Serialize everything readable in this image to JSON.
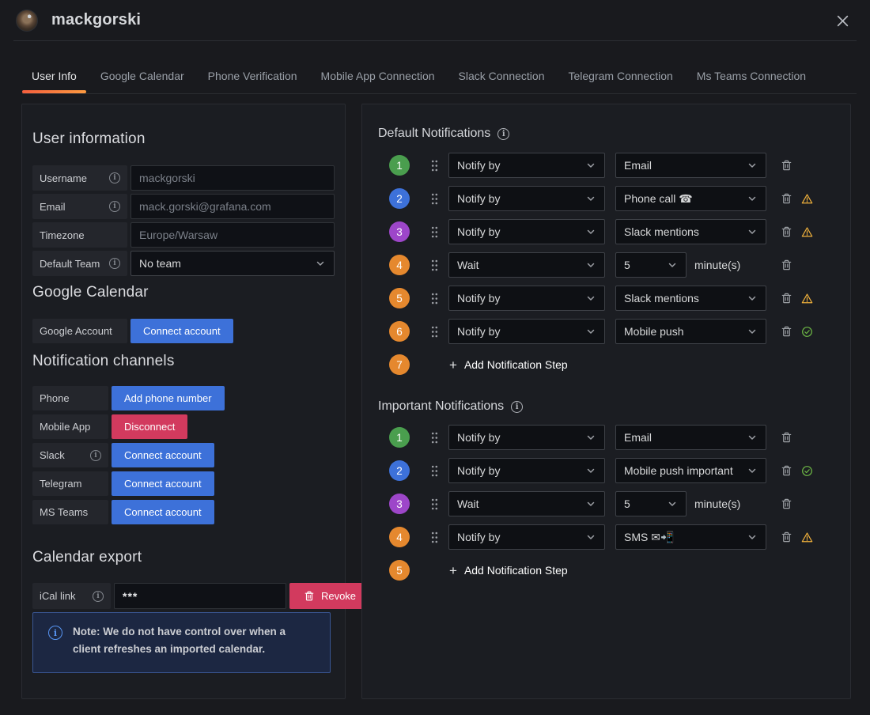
{
  "window": {
    "title": "mackgorski"
  },
  "tabs": [
    {
      "label": "User Info",
      "active": true
    },
    {
      "label": "Google Calendar",
      "active": false
    },
    {
      "label": "Phone Verification",
      "active": false
    },
    {
      "label": "Mobile App Connection",
      "active": false
    },
    {
      "label": "Slack Connection",
      "active": false
    },
    {
      "label": "Telegram Connection",
      "active": false
    },
    {
      "label": "Ms Teams Connection",
      "active": false
    }
  ],
  "user_info": {
    "heading": "User information",
    "fields": [
      {
        "label": "Username",
        "info": true,
        "value": "mackgorski",
        "type": "text"
      },
      {
        "label": "Email",
        "info": true,
        "value": "mack.gorski@grafana.com",
        "type": "text"
      },
      {
        "label": "Timezone",
        "info": false,
        "value": "Europe/Warsaw",
        "type": "text"
      },
      {
        "label": "Default Team",
        "info": true,
        "value": "No team",
        "type": "select"
      }
    ]
  },
  "google_calendar": {
    "heading": "Google Calendar",
    "row": {
      "label": "Google Account",
      "button": "Connect account"
    }
  },
  "channels": {
    "heading": "Notification channels",
    "rows": [
      {
        "label": "Phone",
        "info": false,
        "button": "Add phone number",
        "variant": "primary"
      },
      {
        "label": "Mobile App",
        "info": false,
        "button": "Disconnect",
        "variant": "destructive"
      },
      {
        "label": "Slack",
        "info": true,
        "button": "Connect account",
        "variant": "primary"
      },
      {
        "label": "Telegram",
        "info": false,
        "button": "Connect account",
        "variant": "primary"
      },
      {
        "label": "MS Teams",
        "info": false,
        "button": "Connect account",
        "variant": "primary"
      }
    ]
  },
  "calendar_export": {
    "heading": "Calendar export",
    "label": "iCal link",
    "value": "***",
    "revoke": "Revoke",
    "note": "Note: We do not have control over when a client refreshes an imported calendar."
  },
  "notifications": {
    "default": {
      "heading": "Default Notifications",
      "add_label": "Add Notification Step",
      "steps": [
        {
          "badge": "1",
          "color": "green",
          "action": "Notify by",
          "target": "Email",
          "status": null
        },
        {
          "badge": "2",
          "color": "blue",
          "action": "Notify by",
          "target": "Phone call ☎",
          "status": "warning"
        },
        {
          "badge": "3",
          "color": "purple",
          "action": "Notify by",
          "target": "Slack mentions",
          "status": "warning"
        },
        {
          "badge": "4",
          "color": "orange",
          "action": "Wait",
          "target": "5",
          "suffix": "minute(s)",
          "status": null
        },
        {
          "badge": "5",
          "color": "orange",
          "action": "Notify by",
          "target": "Slack mentions",
          "status": "warning"
        },
        {
          "badge": "6",
          "color": "orange",
          "action": "Notify by",
          "target": "Mobile push",
          "status": "ok"
        },
        {
          "badge": "7",
          "color": "orange",
          "add": true
        }
      ]
    },
    "important": {
      "heading": "Important Notifications",
      "add_label": "Add Notification Step",
      "steps": [
        {
          "badge": "1",
          "color": "green",
          "action": "Notify by",
          "target": "Email",
          "status": null
        },
        {
          "badge": "2",
          "color": "blue",
          "action": "Notify by",
          "target": "Mobile push important",
          "status": "ok"
        },
        {
          "badge": "3",
          "color": "purple",
          "action": "Wait",
          "target": "5",
          "suffix": "minute(s)",
          "status": null
        },
        {
          "badge": "4",
          "color": "orange",
          "action": "Notify by",
          "target": "SMS ✉📲",
          "status": "warning"
        },
        {
          "badge": "5",
          "color": "orange",
          "add": true
        }
      ]
    }
  },
  "colors": {
    "badge_green": "#4a9e4e",
    "badge_blue": "#3d71d9",
    "badge_purple": "#9d46c9",
    "badge_orange": "#e5882e",
    "primary_blue": "#3d71d9",
    "destructive_red": "#d23a5e",
    "warning_amber": "#f0b13c",
    "success_green": "#6cb545",
    "tab_accent": "#f87c2e",
    "note_blue": "#5794f2"
  }
}
